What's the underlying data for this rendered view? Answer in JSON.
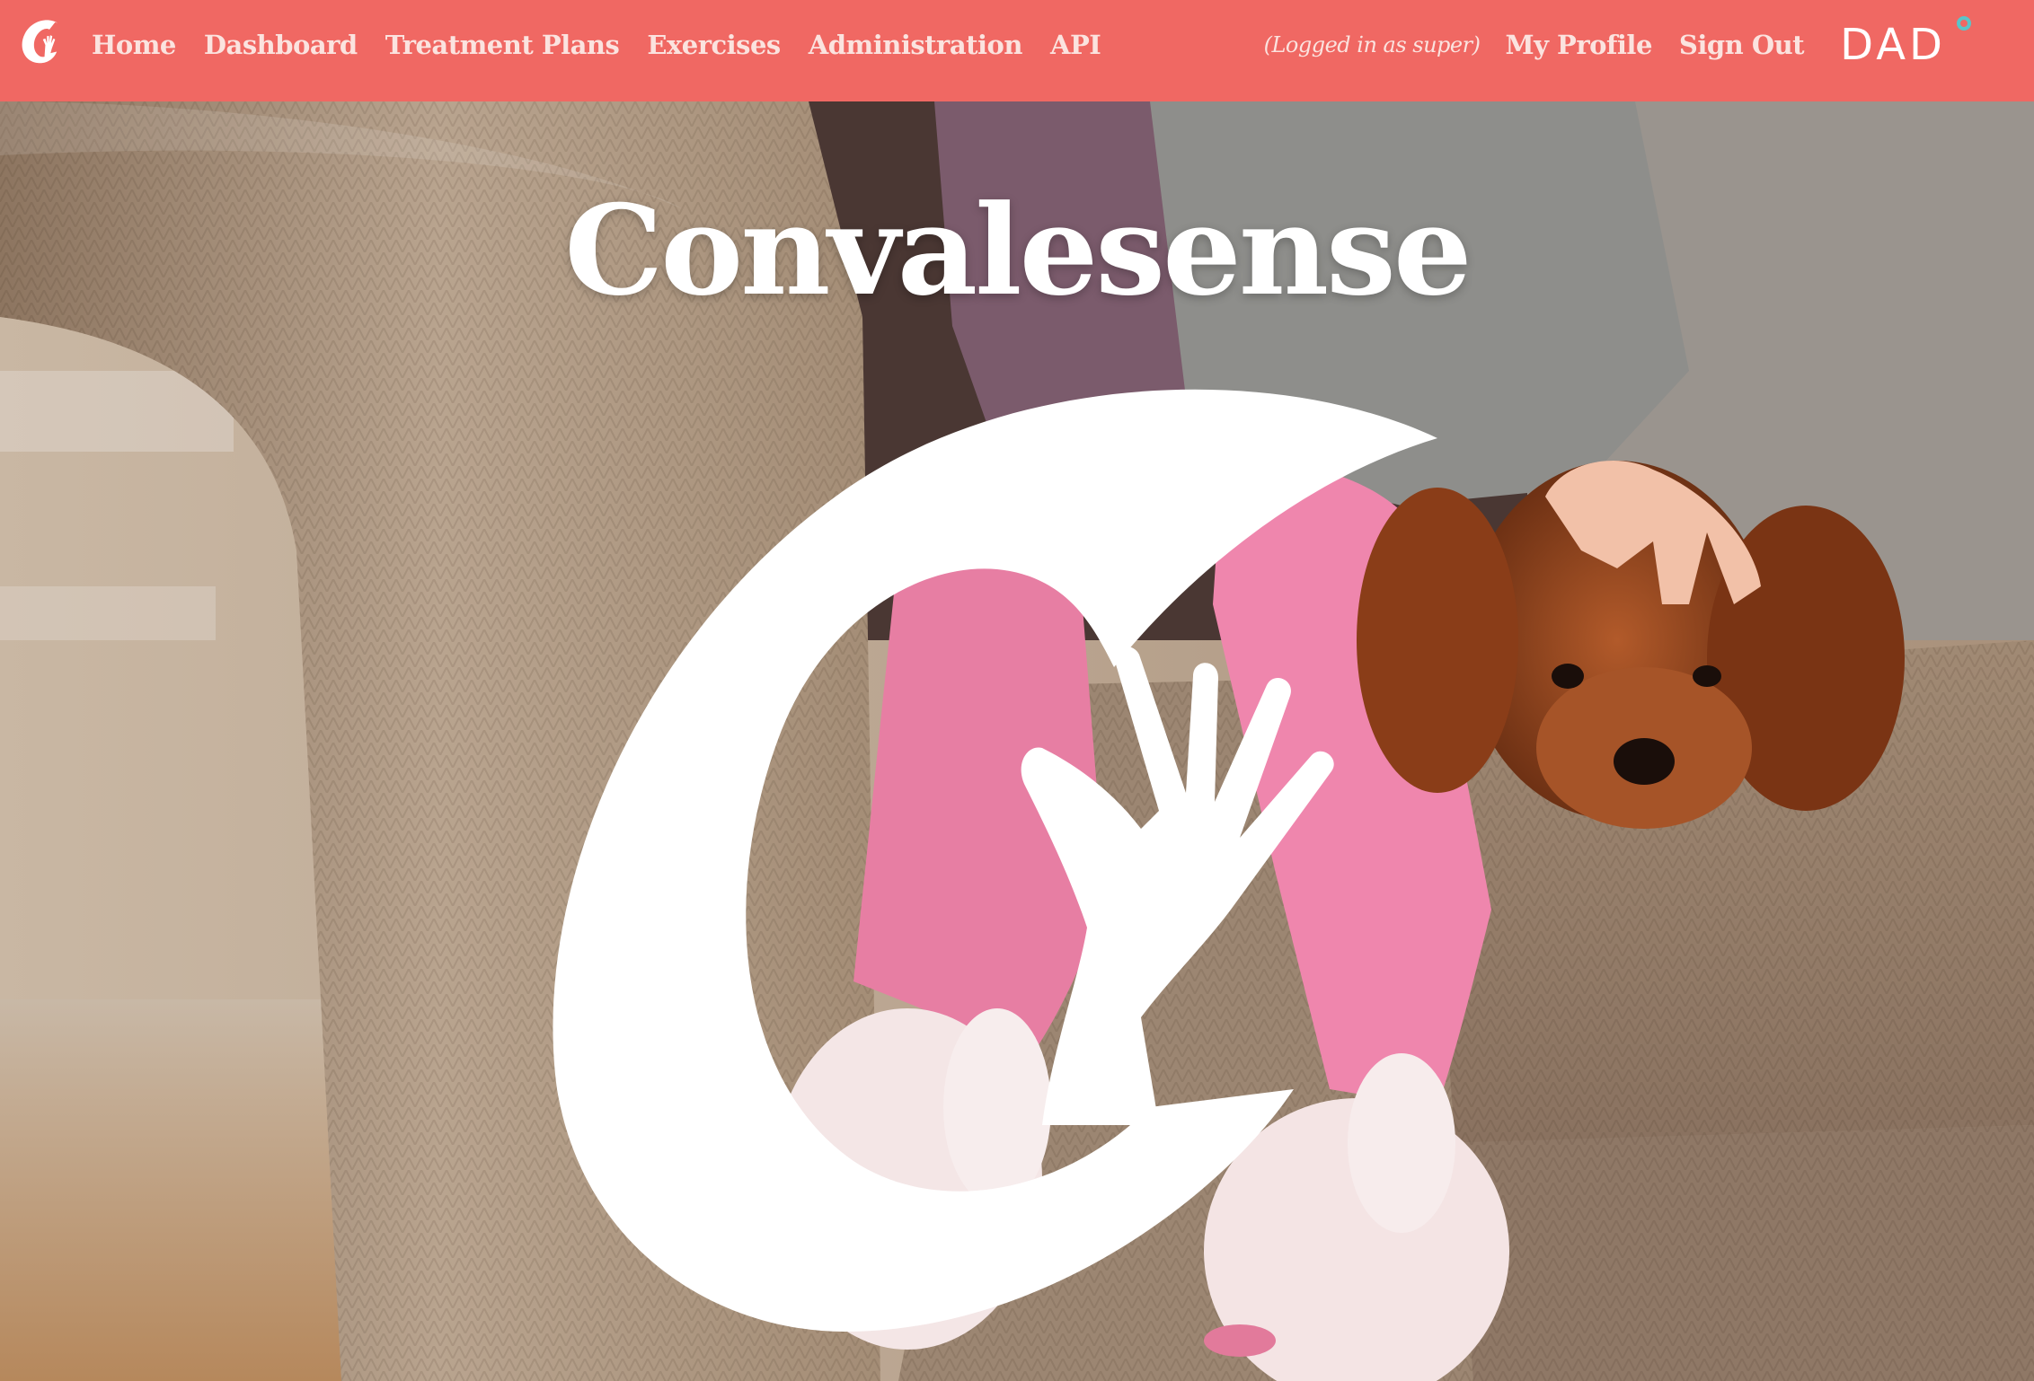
{
  "navbar": {
    "logo_icon": "convalesense-c-icon",
    "background": "#f06863",
    "links": [
      {
        "label": "Home"
      },
      {
        "label": "Dashboard"
      },
      {
        "label": "Treatment Plans"
      },
      {
        "label": "Exercises"
      },
      {
        "label": "Administration"
      },
      {
        "label": "API"
      }
    ],
    "logged_in_text": "(Logged in as super)",
    "my_profile_label": "My Profile",
    "sign_out_label": "Sign Out",
    "brand": "DAD",
    "brand_dot_color": "#5bc4c9"
  },
  "hero": {
    "title": "Convalesense",
    "mark_icon": "convalesense-c-hand-icon",
    "background_scene": "child-on-sofa-with-puppy-photo"
  }
}
